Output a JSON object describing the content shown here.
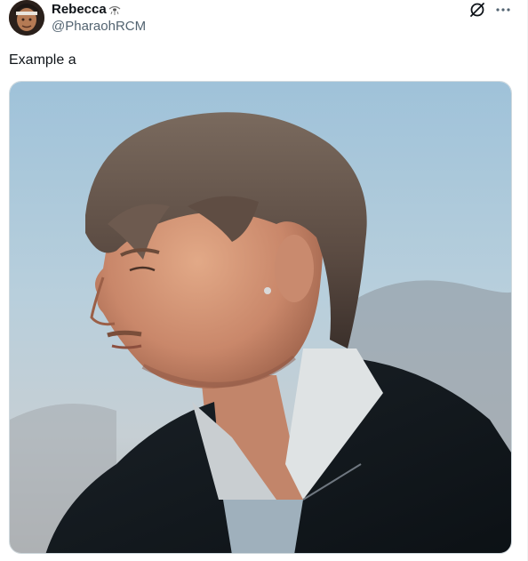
{
  "post": {
    "author": {
      "name": "Rebecca",
      "handle": "@PharaohRCM"
    },
    "text": "Example a"
  },
  "icons": {
    "grok": "grok-icon",
    "more": "more-dots-icon",
    "name_badge": "eye-emoji-icon"
  },
  "colors": {
    "text_primary": "#0f1419",
    "text_secondary": "#536471",
    "border": "#cfd9de"
  }
}
